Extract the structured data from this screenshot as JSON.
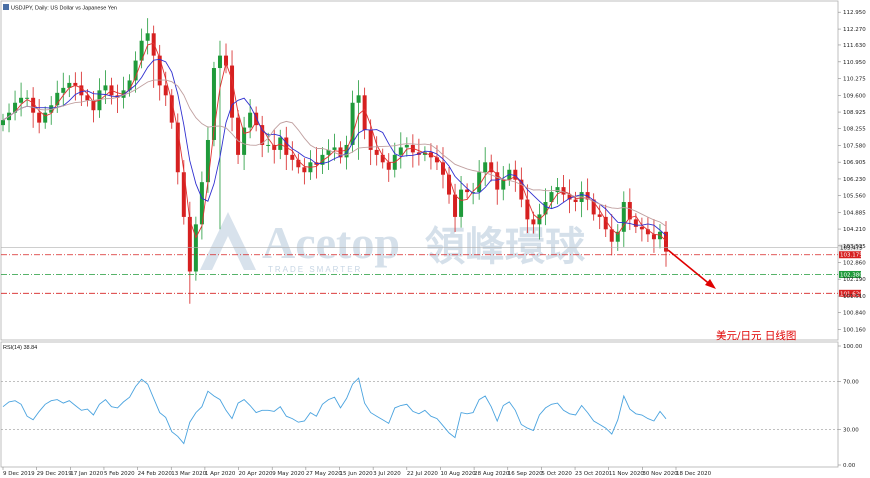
{
  "header": {
    "title": "USDJPY, Daily:  US Dollar vs Japanese Yen",
    "rsi_label": "RSI(14) 38.84"
  },
  "watermark": {
    "brand": "Acetop",
    "chinese": "領峰環球",
    "tagline": "TRADE SMARTER"
  },
  "annotation": "美元/日元   日线图",
  "colors": {
    "up_candle": "#1f9a3a",
    "down_candle": "#d62020",
    "ma_fast": "#e03030",
    "ma_mid": "#3030d0",
    "ma_slow": "#c0a0a0",
    "rsi_line": "#4aa3df",
    "resistance": "#d62020",
    "support": "#1f9a3a",
    "arrow": "#e00000"
  },
  "chart_data": {
    "type": "candlestick",
    "symbol": "USDJPY",
    "timeframe": "Daily",
    "y_ticks": [
      "112.950",
      "112.270",
      "111.630",
      "110.950",
      "110.275",
      "109.600",
      "108.925",
      "108.255",
      "107.580",
      "106.905",
      "106.230",
      "105.560",
      "104.885",
      "104.210",
      "103.535",
      "102.860",
      "102.190",
      "101.510",
      "100.840",
      "100.160"
    ],
    "ylim": [
      99.9,
      113.2
    ],
    "x_ticks": [
      "9 Dec 2019",
      "29 Dec 2019",
      "17 Jan 2020",
      "5 Feb 2020",
      "24 Feb 2020",
      "13 Mar 2020",
      "1 Apr 2020",
      "20 Apr 2020",
      "9 May 2020",
      "27 May 2020",
      "15 Jun 2020",
      "3 Jul 2020",
      "22 Jul 2020",
      "10 Aug 2020",
      "28 Aug 2020",
      "16 Sep 2020",
      "5 Oct 2020",
      "23 Oct 2020",
      "11 Nov 2020",
      "30 Nov 2020",
      "18 Dec 2020"
    ],
    "levels": [
      {
        "price": 103.175,
        "label": "103.175",
        "style": "dash-dot",
        "color": "#d62020"
      },
      {
        "price": 102.38,
        "label": "102.380",
        "style": "dash-dot",
        "color": "#1f9a3a"
      },
      {
        "price": 101.62,
        "label": "101.620",
        "style": "dash-dot",
        "color": "#d62020"
      }
    ],
    "current_price": "103.475",
    "close_series": [
      108.6,
      108.9,
      109.3,
      109.5,
      109.5,
      108.9,
      108.5,
      108.9,
      109.2,
      109.7,
      109.9,
      110.1,
      110.0,
      109.6,
      109.4,
      109.0,
      109.8,
      110.0,
      109.6,
      109.5,
      109.8,
      110.2,
      111.0,
      111.8,
      112.1,
      111.2,
      110.0,
      109.6,
      108.5,
      106.5,
      104.7,
      102.5,
      104.4,
      106.1,
      107.8,
      110.7,
      111.2,
      110.8,
      108.7,
      107.2,
      108.3,
      108.9,
      108.4,
      107.6,
      107.6,
      107.4,
      107.9,
      107.2,
      107.0,
      106.7,
      106.5,
      106.9,
      106.8,
      107.2,
      107.4,
      107.5,
      107.1,
      107.6,
      109.3,
      109.6,
      108.2,
      107.4,
      107.2,
      106.9,
      106.6,
      107.2,
      107.5,
      107.6,
      107.3,
      107.2,
      107.3,
      107.1,
      106.9,
      106.4,
      105.6,
      104.7,
      105.8,
      105.7,
      105.7,
      106.5,
      106.9,
      106.5,
      105.8,
      106.2,
      106.6,
      106.2,
      105.4,
      104.6,
      104.4,
      104.8,
      105.3,
      105.7,
      105.9,
      105.6,
      105.4,
      105.3,
      105.7,
      105.4,
      104.8,
      104.7,
      104.2,
      103.7,
      104.1,
      105.3,
      104.6,
      104.3,
      104.2,
      104.0,
      103.8,
      104.1,
      103.3
    ],
    "rsi": {
      "name": "RSI(14)",
      "last": 38.84,
      "levels": [
        70,
        30
      ],
      "y_ticks": [
        "100.00",
        "70.00",
        "30.00",
        "0.00"
      ],
      "ylim": [
        0,
        100
      ],
      "values": [
        49,
        53,
        54,
        51,
        41,
        38,
        45,
        51,
        54,
        55,
        52,
        54,
        50,
        46,
        47,
        42,
        51,
        55,
        49,
        48,
        53,
        57,
        66,
        72,
        68,
        56,
        44,
        40,
        28,
        24,
        18,
        36,
        44,
        49,
        62,
        58,
        55,
        46,
        39,
        52,
        55,
        50,
        44,
        46,
        46,
        45,
        49,
        41,
        39,
        36,
        37,
        44,
        41,
        51,
        55,
        57,
        48,
        56,
        68,
        73,
        52,
        44,
        41,
        38,
        35,
        48,
        50,
        51,
        45,
        43,
        46,
        41,
        39,
        33,
        27,
        23,
        44,
        43,
        44,
        55,
        58,
        49,
        37,
        50,
        53,
        46,
        34,
        31,
        29,
        42,
        48,
        51,
        52,
        46,
        43,
        42,
        50,
        44,
        37,
        34,
        31,
        26,
        38,
        58,
        47,
        43,
        42,
        39,
        37,
        45,
        38.84
      ]
    }
  }
}
